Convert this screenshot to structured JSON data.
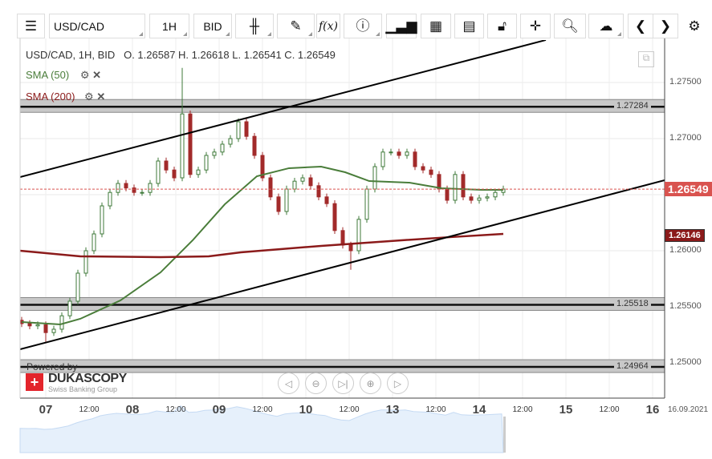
{
  "toolbar": {
    "menu_icon": "hamburger-icon",
    "symbol": "USD/CAD",
    "period": "1H",
    "side": "BID",
    "fx_label": "f(x)",
    "buttons": [
      "candlestick-icon",
      "pencil-icon",
      "function-icon",
      "info-icon",
      "bar-chart-icon",
      "calendar-icon",
      "news-icon",
      "lock-icon",
      "crosshair-icon",
      "zoom-icon",
      "cloud-upload-icon",
      "chevron-left-icon",
      "chevron-right-icon",
      "gear-icon"
    ]
  },
  "legend": {
    "title": "USD/CAD, 1H, BID",
    "ohlc": "O. 1.26587 H. 1.26618 L. 1.26541 C. 1.26549",
    "indicators": [
      {
        "label": "SMA (50)",
        "color": "#4a7d3a"
      },
      {
        "label": "SMA (200)",
        "color": "#8b1a1a"
      }
    ]
  },
  "branding": {
    "powered_by": "Powered by",
    "logo": "DUKASCOPY",
    "tagline": "Swiss Banking Group"
  },
  "chart_data": {
    "type": "candlestick",
    "title": "USD/CAD, 1H, BID",
    "ylim": [
      1.2465,
      1.2785
    ],
    "y_ticks": [
      "1.27500",
      "1.27000",
      "1.26500",
      "1.26000",
      "1.25500",
      "1.25000"
    ],
    "y_tick_values": [
      1.275,
      1.27,
      1.265,
      1.26,
      1.255,
      1.25
    ],
    "x_ticks": [
      {
        "label": "07",
        "day": true,
        "i": 3
      },
      {
        "label": "12:00",
        "day": false,
        "i": 8.4
      },
      {
        "label": "08",
        "day": true,
        "i": 13.8
      },
      {
        "label": "12:00",
        "day": false,
        "i": 19.2
      },
      {
        "label": "09",
        "day": true,
        "i": 24.6
      },
      {
        "label": "12:00",
        "day": false,
        "i": 30
      },
      {
        "label": "10",
        "day": true,
        "i": 35.4
      },
      {
        "label": "12:00",
        "day": false,
        "i": 40.8
      },
      {
        "label": "13",
        "day": true,
        "i": 46.2
      },
      {
        "label": "12:00",
        "day": false,
        "i": 51.6
      },
      {
        "label": "14",
        "day": true,
        "i": 57
      },
      {
        "label": "12:00",
        "day": false,
        "i": 62.4
      },
      {
        "label": "15",
        "day": true,
        "i": 67.8
      },
      {
        "label": "12:00",
        "day": false,
        "i": 73.2
      },
      {
        "label": "16",
        "day": true,
        "i": 78.6
      }
    ],
    "date_label": "16.09.2021",
    "closes": [
      1.2535,
      1.2533,
      1.2534,
      1.2527,
      1.253,
      1.2542,
      1.2555,
      1.258,
      1.26,
      1.2615,
      1.264,
      1.2652,
      1.266,
      1.2656,
      1.2652,
      1.2652,
      1.266,
      1.268,
      1.2672,
      1.2665,
      1.2722,
      1.2668,
      1.2672,
      1.2685,
      1.2688,
      1.2695,
      1.27,
      1.2715,
      1.2702,
      1.2685,
      1.2665,
      1.2648,
      1.2635,
      1.2655,
      1.2662,
      1.2665,
      1.2658,
      1.2648,
      1.2642,
      1.2618,
      1.2605,
      1.26,
      1.2628,
      1.2655,
      1.2675,
      1.2688,
      1.2688,
      1.2685,
      1.2688,
      1.2675,
      1.2672,
      1.2668,
      1.2655,
      1.2645,
      1.2668,
      1.2648,
      1.2645,
      1.2647,
      1.2648,
      1.2652,
      1.2655
    ],
    "spikes": [
      {
        "i": 20,
        "high": 1.2763
      },
      {
        "i": 41,
        "low": 1.2583
      },
      {
        "i": 3,
        "low": 1.2518
      }
    ],
    "sma50": [
      [
        0,
        1.25364
      ],
      [
        4.8,
        1.25343
      ],
      [
        7.3,
        1.25393
      ],
      [
        12.3,
        1.25557
      ],
      [
        17.3,
        1.25807
      ],
      [
        21.3,
        1.26093
      ],
      [
        25.3,
        1.26414
      ],
      [
        29.3,
        1.26664
      ],
      [
        33.3,
        1.26736
      ],
      [
        37.3,
        1.2675
      ],
      [
        40.3,
        1.267
      ],
      [
        43.3,
        1.26621
      ],
      [
        48.3,
        1.26607
      ],
      [
        52.3,
        1.26557
      ],
      [
        57.3,
        1.26543
      ],
      [
        60,
        1.26543
      ]
    ],
    "sma200": [
      [
        -0.2,
        1.26
      ],
      [
        7.3,
        1.2595
      ],
      [
        17.3,
        1.25943
      ],
      [
        23.3,
        1.2595
      ],
      [
        27.3,
        1.25986
      ],
      [
        37.3,
        1.26043
      ],
      [
        47.3,
        1.26093
      ],
      [
        53.3,
        1.26121
      ],
      [
        60,
        1.2615
      ]
    ],
    "trendlines": [
      [
        [
          -0.2,
          1.26657
        ],
        [
          65.3,
          1.27879
        ]
      ],
      [
        [
          -0.2,
          1.25121
        ],
        [
          80.1,
          1.26629
        ]
      ]
    ],
    "levels": [
      "1.27284",
      "1.25518",
      "1.24964"
    ],
    "level_values": [
      1.27284,
      1.25518,
      1.24964
    ],
    "last_price": "1.26549",
    "last_price_value": 1.26549,
    "sma200_last": "1.26146",
    "sma200_last_value": 1.26146,
    "colors": {
      "up": "#3f7a3a",
      "down": "#a22a2a",
      "sma50": "#4a7d3a",
      "sma200": "#8b1a1a",
      "last": "#d9534f"
    }
  }
}
